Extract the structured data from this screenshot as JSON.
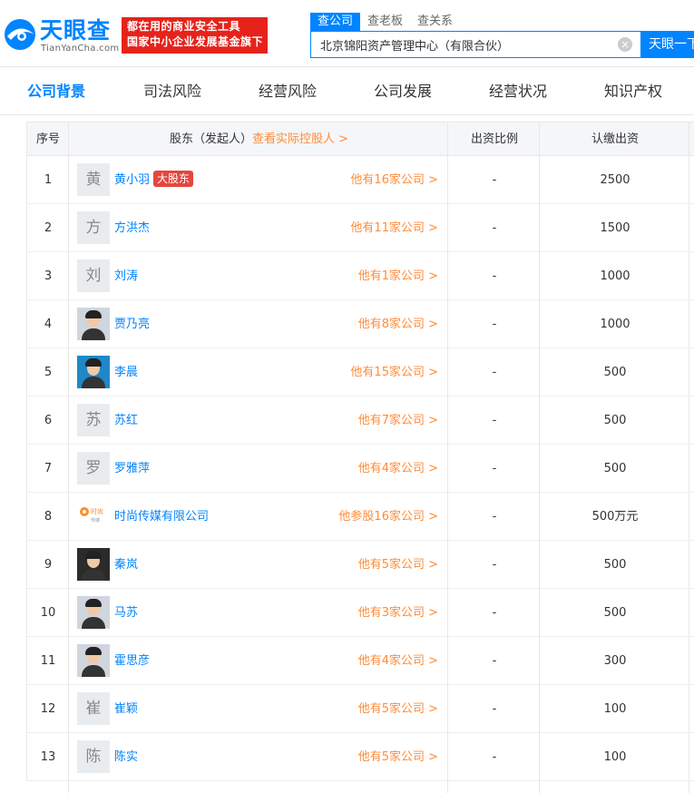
{
  "brand": {
    "name": "天眼查",
    "domain": "TianYanCha.com",
    "slogan_line1": "都在用的商业安全工具",
    "slogan_line2": "国家中小企业发展基金旗下"
  },
  "search": {
    "tabs": [
      "查公司",
      "查老板",
      "查关系"
    ],
    "active_tab": "查公司",
    "value": "北京锦阳资产管理中心（有限合伙）",
    "clear_icon": "⊗",
    "button_label": "天眼一下"
  },
  "nav": {
    "items": [
      "公司背景",
      "司法风险",
      "经营风险",
      "公司发展",
      "经营状况",
      "知识产权"
    ],
    "active": "公司背景"
  },
  "table": {
    "headers": {
      "index": "序号",
      "shareholder": "股东（发起人）",
      "controller_link": "查看实际控股人 >",
      "ratio": "出资比例",
      "amount": "认缴出资"
    },
    "rows": [
      {
        "index": "1",
        "avatar": "黄",
        "avatar_type": "text",
        "name": "黄小羽",
        "badge": "大股东",
        "companies": "他有16家公司 >",
        "ratio": "-",
        "amount": "2500"
      },
      {
        "index": "2",
        "avatar": "方",
        "avatar_type": "text",
        "name": "方洪杰",
        "badge": "",
        "companies": "他有11家公司 >",
        "ratio": "-",
        "amount": "1500"
      },
      {
        "index": "3",
        "avatar": "刘",
        "avatar_type": "text",
        "name": "刘涛",
        "badge": "",
        "companies": "他有1家公司 >",
        "ratio": "-",
        "amount": "1000"
      },
      {
        "index": "4",
        "avatar": "",
        "avatar_type": "photo-light",
        "name": "贾乃亮",
        "badge": "",
        "companies": "他有8家公司 >",
        "ratio": "-",
        "amount": "1000"
      },
      {
        "index": "5",
        "avatar": "",
        "avatar_type": "photo-blue",
        "name": "李晨",
        "badge": "",
        "companies": "他有15家公司 >",
        "ratio": "-",
        "amount": "500"
      },
      {
        "index": "6",
        "avatar": "苏",
        "avatar_type": "text",
        "name": "苏红",
        "badge": "",
        "companies": "他有7家公司 >",
        "ratio": "-",
        "amount": "500"
      },
      {
        "index": "7",
        "avatar": "罗",
        "avatar_type": "text",
        "name": "罗雅萍",
        "badge": "",
        "companies": "他有4家公司 >",
        "ratio": "-",
        "amount": "500"
      },
      {
        "index": "8",
        "avatar": "",
        "avatar_type": "logo",
        "name": "时尚传媒有限公司",
        "badge": "",
        "companies": "他参股16家公司 >",
        "ratio": "-",
        "amount": "500万元"
      },
      {
        "index": "9",
        "avatar": "",
        "avatar_type": "photo",
        "name": "秦岚",
        "badge": "",
        "companies": "他有5家公司 >",
        "ratio": "-",
        "amount": "500"
      },
      {
        "index": "10",
        "avatar": "",
        "avatar_type": "photo-light",
        "name": "马苏",
        "badge": "",
        "companies": "他有3家公司 >",
        "ratio": "-",
        "amount": "500"
      },
      {
        "index": "11",
        "avatar": "",
        "avatar_type": "photo-light",
        "name": "霍思彦",
        "badge": "",
        "companies": "他有4家公司 >",
        "ratio": "-",
        "amount": "300"
      },
      {
        "index": "12",
        "avatar": "崔",
        "avatar_type": "text",
        "name": "崔颖",
        "badge": "",
        "companies": "他有5家公司 >",
        "ratio": "-",
        "amount": "100"
      },
      {
        "index": "13",
        "avatar": "陈",
        "avatar_type": "text",
        "name": "陈实",
        "badge": "",
        "companies": "他有5家公司 >",
        "ratio": "-",
        "amount": "100"
      }
    ]
  },
  "colors": {
    "accent": "#0084ff",
    "brand_red": "#e5231b",
    "link_orange": "#ff8c3a",
    "badge_red": "#e5463d"
  }
}
